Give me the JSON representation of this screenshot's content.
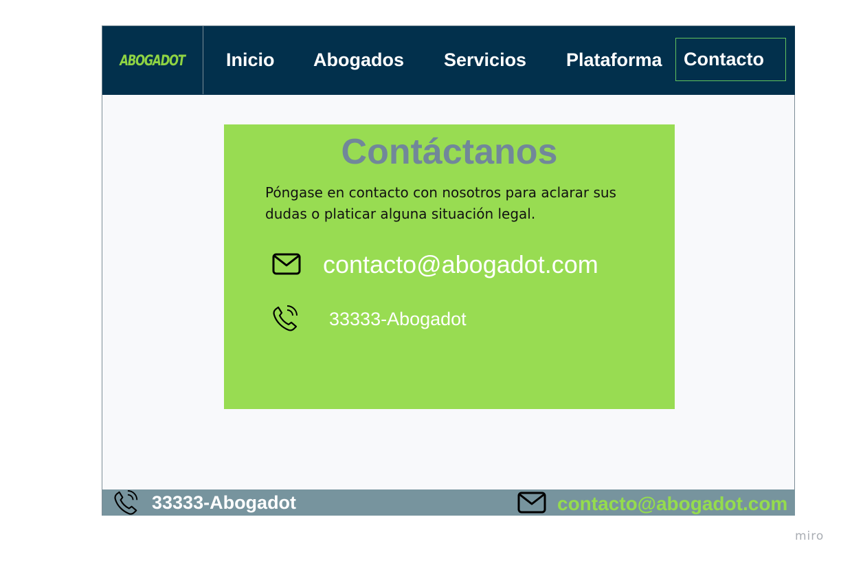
{
  "brand": {
    "logo": "ABOGADOT",
    "accent": "#8fd443",
    "navbar_bg": "#02304c"
  },
  "nav": {
    "items": [
      {
        "label": "Inicio"
      },
      {
        "label": "Abogados"
      },
      {
        "label": "Servicios"
      },
      {
        "label": "Plataforma"
      },
      {
        "label": "Contacto",
        "active": true
      }
    ]
  },
  "contact_card": {
    "title": "Contáctanos",
    "description": "Póngase en contacto con nosotros para aclarar sus dudas o platicar alguna situación legal.",
    "email": "contacto@abogadot.com",
    "phone": "33333-Abogadot",
    "email_icon": "envelope-icon",
    "phone_icon": "phone-ringing-icon",
    "background": "#98dc52"
  },
  "footer": {
    "phone": "33333-Abogadot",
    "email": "contacto@abogadot.com",
    "background": "#77949e"
  },
  "watermark": "miro"
}
